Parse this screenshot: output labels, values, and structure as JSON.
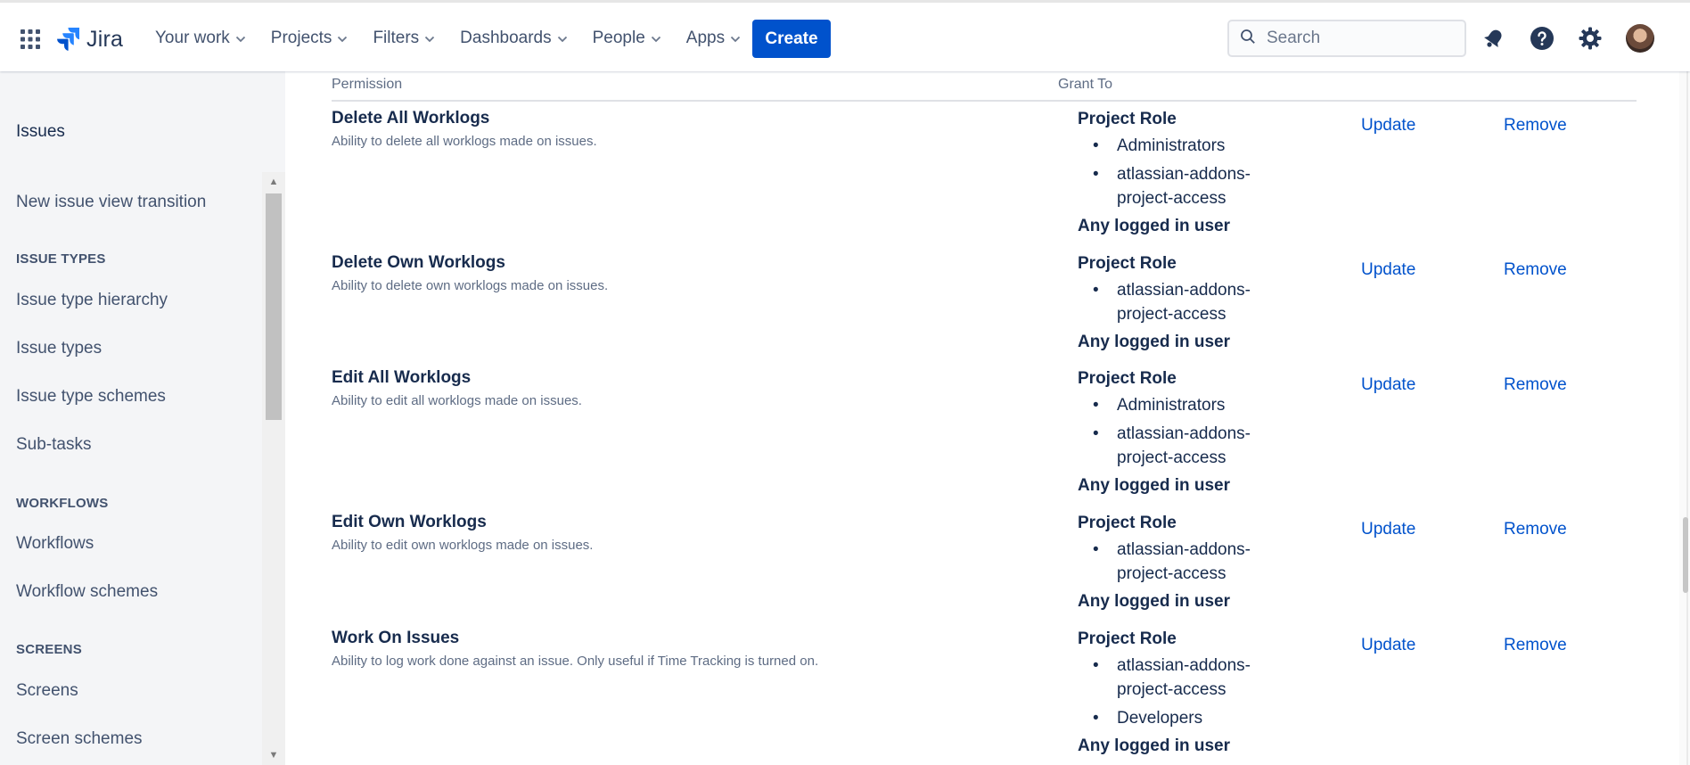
{
  "header": {
    "logo_text": "Jira",
    "nav": [
      "Your work",
      "Projects",
      "Filters",
      "Dashboards",
      "People",
      "Apps"
    ],
    "create_label": "Create",
    "search_placeholder": "Search"
  },
  "sidebar": {
    "issues_label": "Issues",
    "links_top": [
      "New issue view transition"
    ],
    "sections": [
      {
        "heading": "ISSUE TYPES",
        "items": [
          "Issue type hierarchy",
          "Issue types",
          "Issue type schemes",
          "Sub-tasks"
        ]
      },
      {
        "heading": "WORKFLOWS",
        "items": [
          "Workflows",
          "Workflow schemes"
        ]
      },
      {
        "heading": "SCREENS",
        "items": [
          "Screens",
          "Screen schemes"
        ]
      }
    ]
  },
  "table": {
    "col_permission": "Permission",
    "col_grant_to": "Grant To",
    "update_label": "Update",
    "remove_label": "Remove",
    "rows": [
      {
        "name": "Delete All Worklogs",
        "description": "Ability to delete all worklogs made on issues.",
        "grant_title": "Project Role",
        "roles": [
          "Administrators",
          "atlassian-addons-project-access"
        ],
        "any": "Any logged in user"
      },
      {
        "name": "Delete Own Worklogs",
        "description": "Ability to delete own worklogs made on issues.",
        "grant_title": "Project Role",
        "roles": [
          "atlassian-addons-project-access"
        ],
        "any": "Any logged in user"
      },
      {
        "name": "Edit All Worklogs",
        "description": "Ability to edit all worklogs made on issues.",
        "grant_title": "Project Role",
        "roles": [
          "Administrators",
          "atlassian-addons-project-access"
        ],
        "any": "Any logged in user"
      },
      {
        "name": "Edit Own Worklogs",
        "description": "Ability to edit own worklogs made on issues.",
        "grant_title": "Project Role",
        "roles": [
          "atlassian-addons-project-access"
        ],
        "any": "Any logged in user"
      },
      {
        "name": "Work On Issues",
        "description": "Ability to log work done against an issue. Only useful if Time Tracking is turned on.",
        "grant_title": "Project Role",
        "roles": [
          "atlassian-addons-project-access",
          "Developers"
        ],
        "any": "Any logged in user"
      }
    ]
  },
  "colors": {
    "accent": "#0052cc",
    "text": "#172b4d",
    "muted": "#5e6c84",
    "sidebar_bg": "#f4f5f7"
  }
}
